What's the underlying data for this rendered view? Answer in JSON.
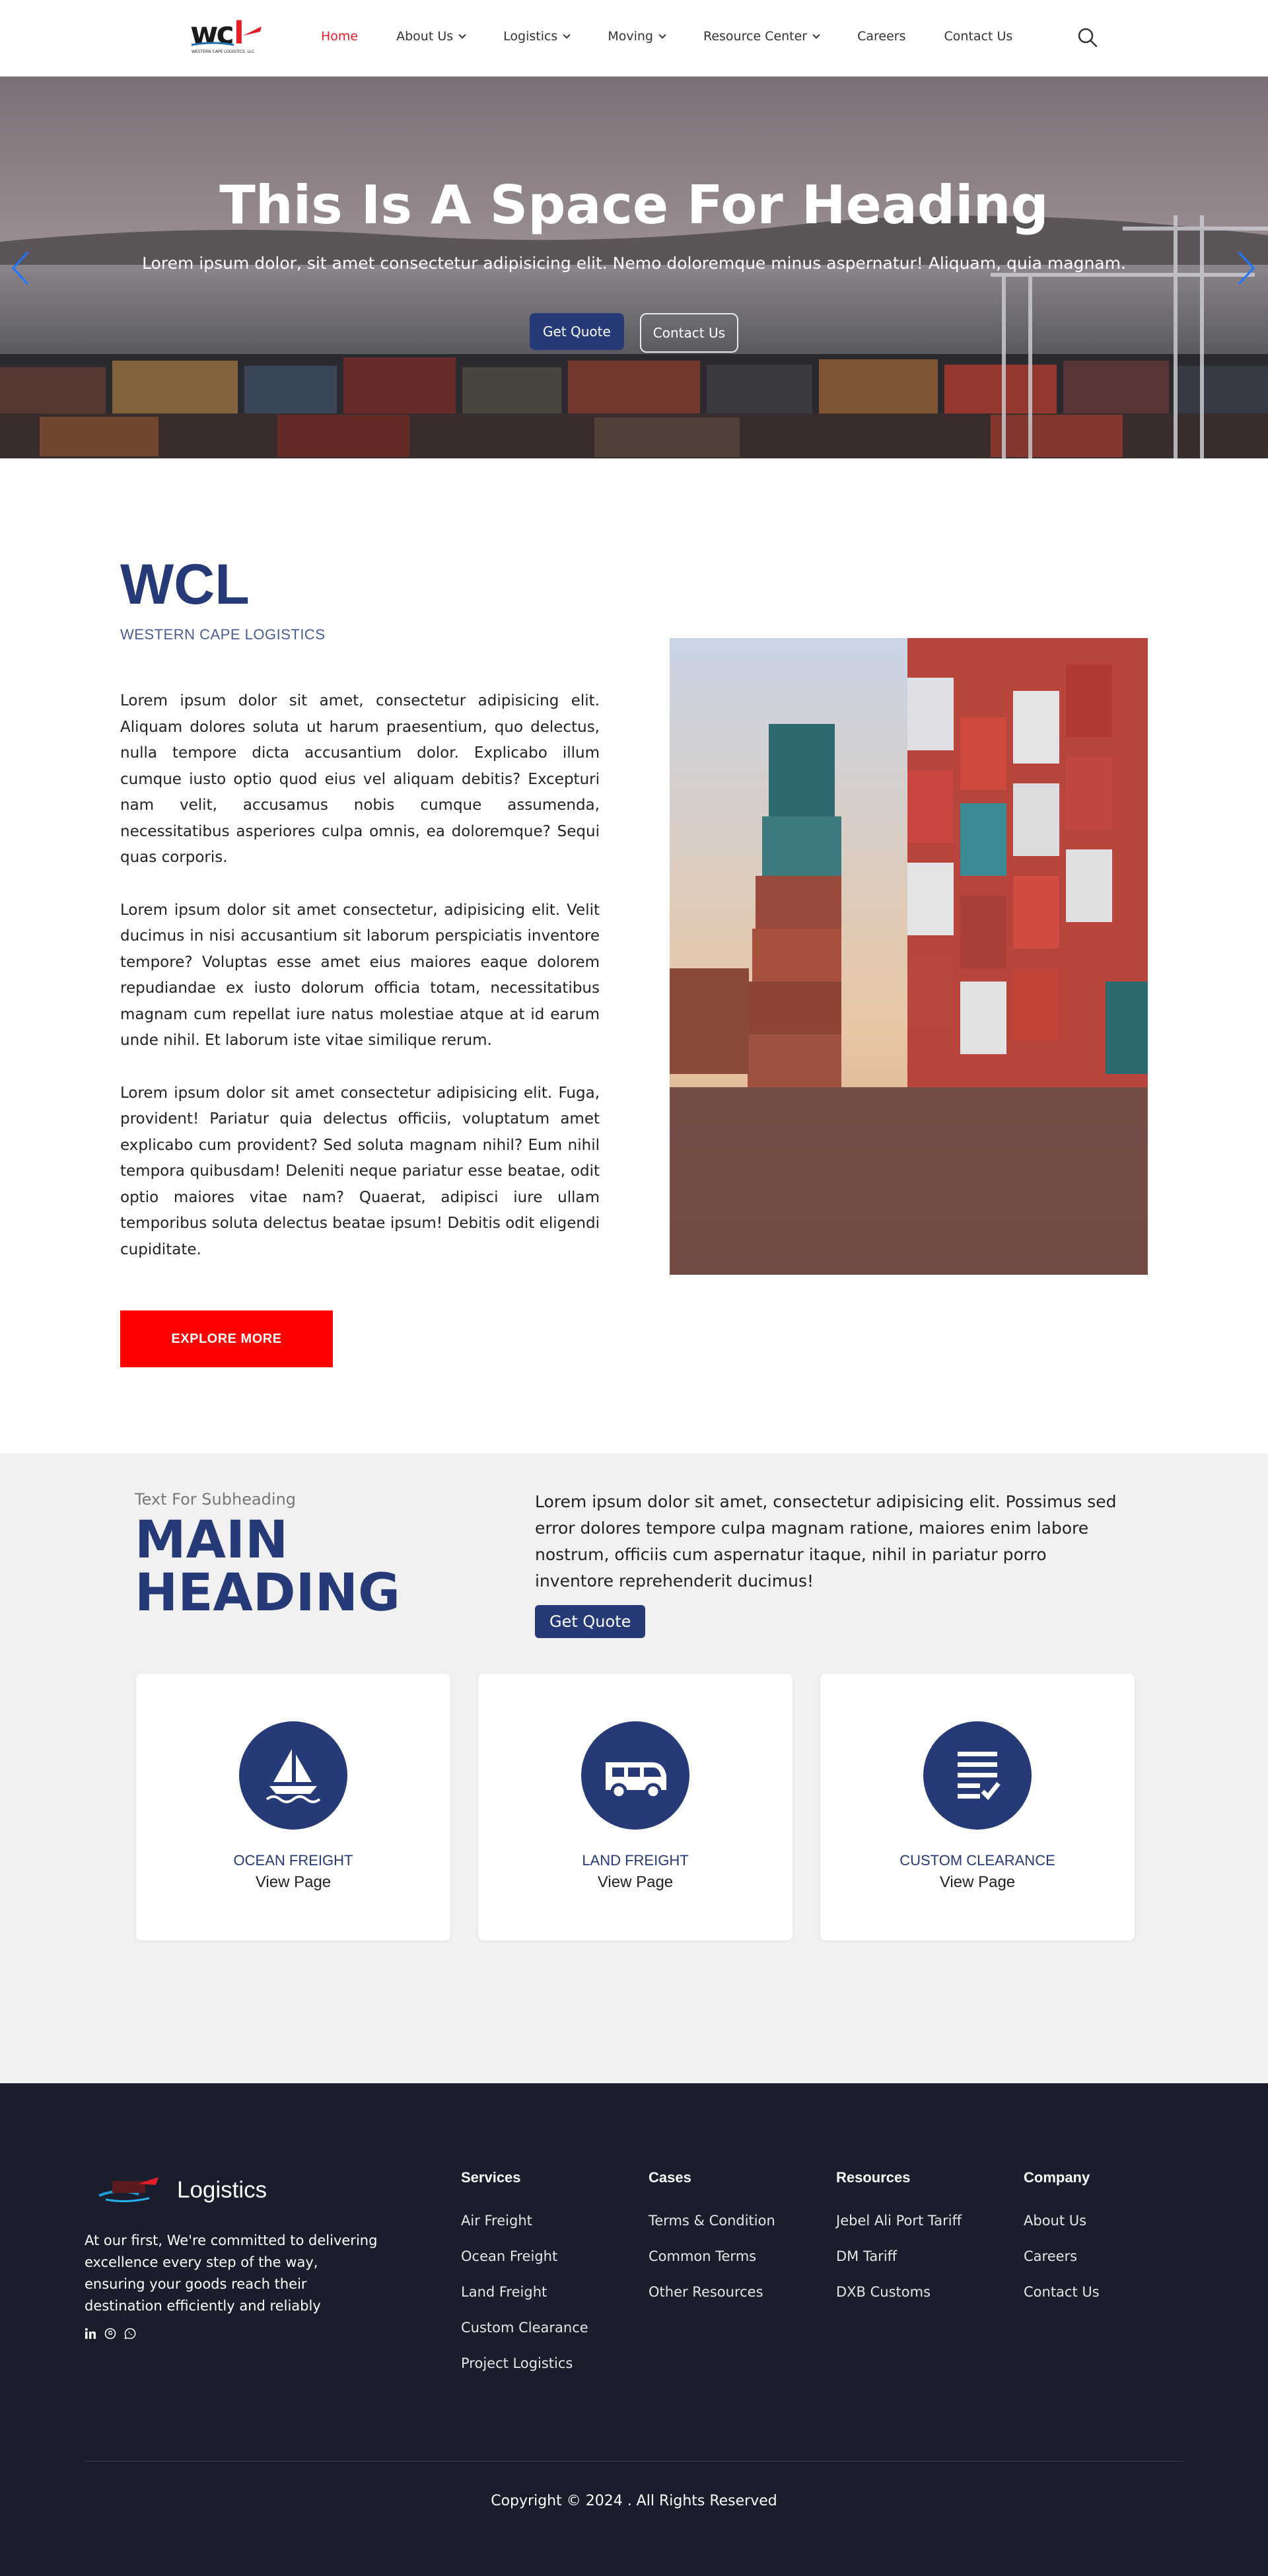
{
  "nav": {
    "logo_text": "wcl",
    "logo_caption": "WESTERN CAPE LOGISTICS, LLC",
    "items": [
      {
        "label": "Home",
        "active": true,
        "dropdown": false
      },
      {
        "label": "About Us",
        "active": false,
        "dropdown": true
      },
      {
        "label": "Logistics",
        "active": false,
        "dropdown": true
      },
      {
        "label": "Moving",
        "active": false,
        "dropdown": true
      },
      {
        "label": "Resource Center",
        "active": false,
        "dropdown": true
      },
      {
        "label": "Careers",
        "active": false,
        "dropdown": false
      },
      {
        "label": "Contact Us",
        "active": false,
        "dropdown": false
      }
    ],
    "search_icon": "search-icon"
  },
  "hero": {
    "title": "This Is A Space For Heading",
    "subtitle": "Lorem ipsum dolor, sit amet consectetur adipisicing elit. Nemo doloremque minus aspernatur! Aliquam, quia magnam.",
    "primary_button": "Get Quote",
    "secondary_button": "Contact Us"
  },
  "about": {
    "title": "WCL",
    "subtitle": "WESTERN CAPE LOGISTICS",
    "paragraphs": [
      "Lorem ipsum dolor sit amet, consectetur adipisicing elit. Aliquam dolores soluta ut harum praesentium, quo delectus, nulla tempore dicta accusantium dolor. Explicabo illum cumque iusto optio quod eius vel aliquam debitis? Excepturi nam velit, accusamus nobis cumque assumenda, necessitatibus asperiores culpa omnis, ea doloremque? Sequi quas corporis.",
      "Lorem ipsum dolor sit amet consectetur, adipisicing elit. Velit ducimus in nisi accusantium sit laborum perspiciatis inventore tempore? Voluptas esse amet eius maiores eaque dolorem repudiandae ex iusto dolorum officia totam, necessitatibus magnam cum repellat iure natus molestiae atque at id earum unde nihil. Et laborum iste vitae similique rerum.",
      "Lorem ipsum dolor sit amet consectetur adipisicing elit. Fuga, provident! Pariatur quia delectus officiis, voluptatum amet explicabo cum provident? Sed soluta magnam nihil? Eum nihil tempora quibusdam! Deleniti neque pariatur esse beatae, odit optio maiores vitae nam? Quaerat, adipisci iure ullam temporibus soluta delectus beatae ipsum! Debitis odit eligendi cupiditate."
    ],
    "button": "EXPLORE MORE"
  },
  "services": {
    "subheading": "Text For Subheading",
    "heading": "MAIN HEADING",
    "text": "Lorem ipsum dolor sit amet, consectetur adipisicing elit. Possimus sed error dolores tempore culpa magnam ratione, maiores enim labore nostrum, officiis cum aspernatur itaque, nihil in pariatur porro inventore reprehenderit ducimus!",
    "button": "Get Quote",
    "cards": [
      {
        "title": "OCEAN FREIGHT",
        "link": "View Page",
        "icon": "sailboat-icon"
      },
      {
        "title": "LAND FREIGHT",
        "link": "View Page",
        "icon": "van-icon"
      },
      {
        "title": "CUSTOM CLEARANCE",
        "link": "View Page",
        "icon": "document-check-icon"
      }
    ]
  },
  "footer": {
    "brand": "Logistics",
    "description": "At our first, We're committed to delivering excellence every step of the way, ensuring your goods reach their destination efficiently and reliably",
    "social": [
      "linkedin-icon",
      "threads-icon",
      "whatsapp-icon"
    ],
    "columns": [
      {
        "heading": "Services",
        "links": [
          "Air Freight",
          "Ocean Freight",
          "Land Freight",
          "Custom Clearance",
          "Project Logistics"
        ]
      },
      {
        "heading": "Cases",
        "links": [
          "Terms & Condition",
          "Common Terms",
          "Other Resources"
        ]
      },
      {
        "heading": "Resources",
        "links": [
          "Jebel Ali Port Tariff",
          "DM Tariff",
          "DXB Customs"
        ]
      },
      {
        "heading": "Company",
        "links": [
          "About Us",
          "Careers",
          "Contact Us"
        ]
      }
    ],
    "copyright": "Copyright © 2024 . All Rights Reserved"
  },
  "colors": {
    "brand_navy": "#253a76",
    "accent_red": "#ff0000",
    "nav_active": "#e41e26",
    "footer_bg": "#1a1d2b",
    "services_bg": "#f1f1f1"
  }
}
